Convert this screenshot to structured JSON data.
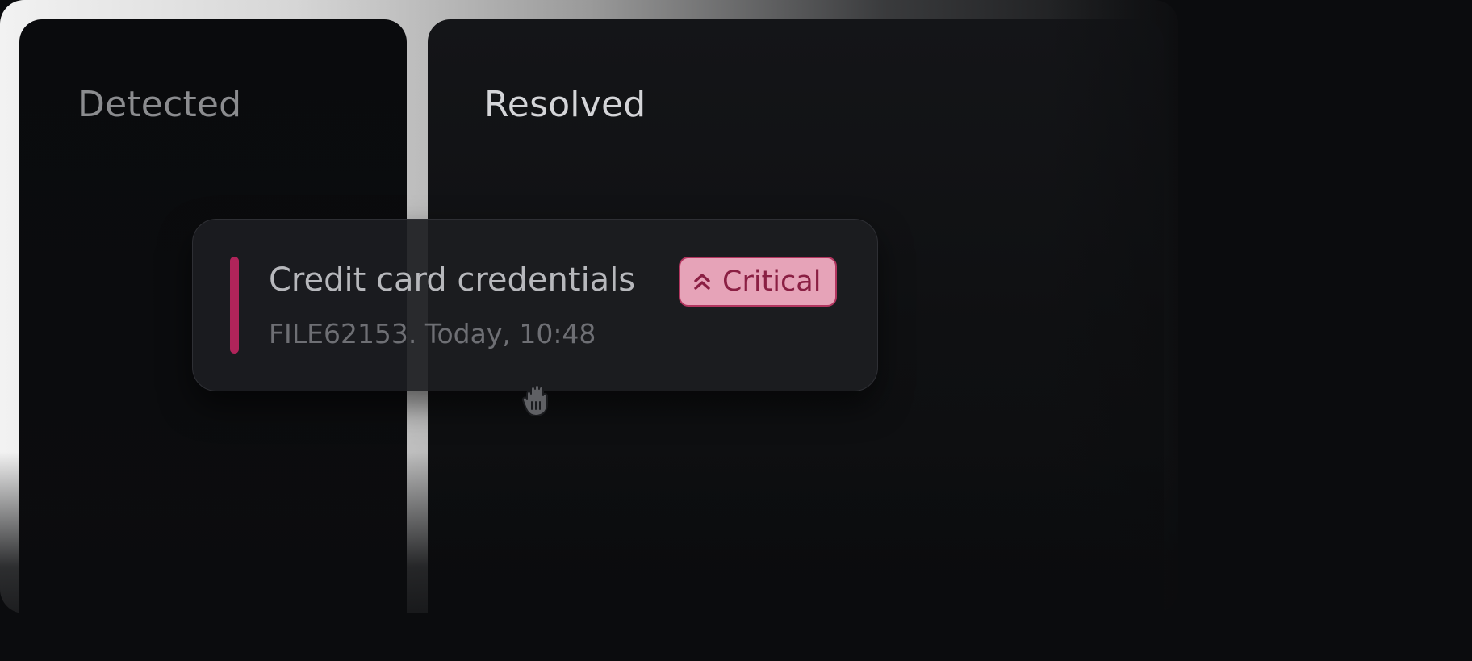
{
  "columns": {
    "detected": {
      "title": "Detected"
    },
    "resolved": {
      "title": "Resolved"
    }
  },
  "card": {
    "title": "Credit card credentials",
    "meta": "FILE62153. Today, 10:48",
    "accent_color": "#b0245a",
    "severity": {
      "label": "Critical",
      "icon": "double-chevron-up-icon",
      "text_color": "#8a1f43",
      "background": "#e6a3b8"
    }
  },
  "cursor": {
    "icon": "grab-hand-icon"
  }
}
